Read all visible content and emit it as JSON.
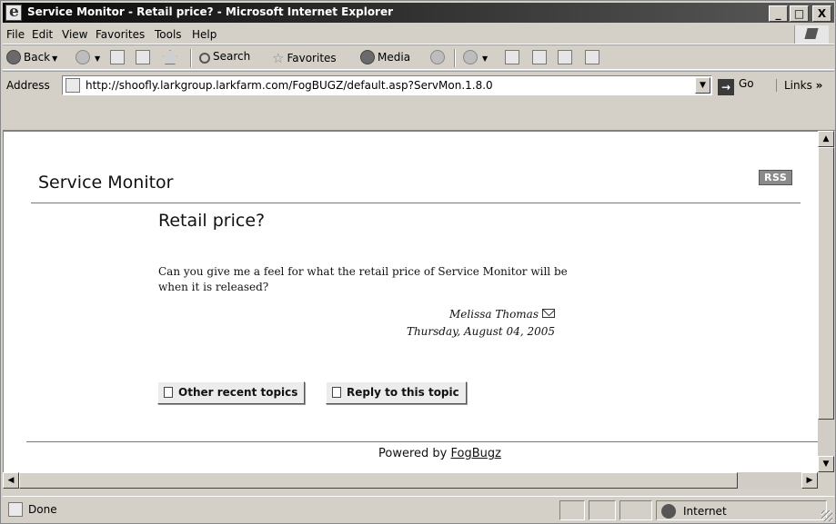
{
  "window": {
    "title": "Service Monitor - Retail price? - Microsoft Internet Explorer",
    "minimize_label": "_",
    "maximize_label": "□",
    "close_label": "X"
  },
  "menu": {
    "file": "File",
    "edit": "Edit",
    "view": "View",
    "favorites": "Favorites",
    "tools": "Tools",
    "help": "Help"
  },
  "toolbar": {
    "back_label": "Back",
    "search_label": "Search",
    "favorites_label": "Favorites",
    "media_label": "Media"
  },
  "address": {
    "label": "Address",
    "url": "http://shoofly.larkgroup.larkfarm.com/FogBUGZ/default.asp?ServMon.1.8.0",
    "go_label": "Go",
    "links_label": "Links"
  },
  "page": {
    "site_title": "Service Monitor",
    "rss_label": "RSS",
    "topic_title": "Retail price?",
    "post_body": "Can you give me a feel for what the retail price of Service Monitor will be when it is released?",
    "author": "Melissa Thomas",
    "date": "Thursday, August 04, 2005",
    "other_topics_button": "Other recent topics",
    "reply_button": "Reply to this topic",
    "powered_by": "Powered by",
    "powered_link": "FogBugz"
  },
  "status": {
    "text": "Done",
    "zone": "Internet"
  },
  "icons": {
    "back": "back-arrow-icon",
    "forward": "forward-arrow-icon",
    "stop": "stop-icon",
    "refresh": "refresh-icon",
    "home": "home-icon",
    "search": "search-icon",
    "favorites": "star-icon",
    "media": "media-icon",
    "history": "history-icon",
    "mail": "mail-icon",
    "print": "printer-icon",
    "edit": "edit-icon",
    "discuss": "discuss-icon",
    "messenger": "messenger-icon"
  }
}
